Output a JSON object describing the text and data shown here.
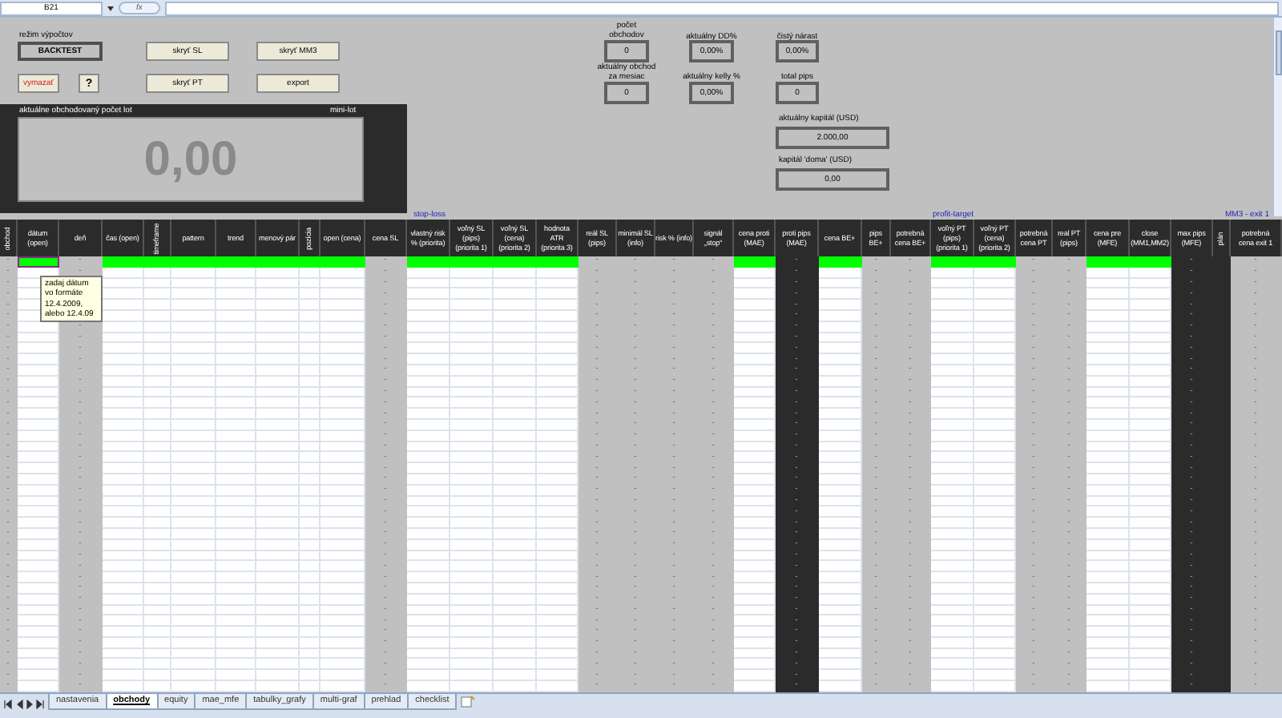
{
  "formula_bar": {
    "name_box": "B21",
    "function_label": "fx"
  },
  "mode": {
    "label": "režim výpočtov"
  },
  "buttons": [
    {
      "label": "BACKTEST",
      "kind": "mode"
    },
    {
      "label": "skryť SL",
      "kind": "action"
    },
    {
      "label": "skryť MM3",
      "kind": "action"
    },
    {
      "label": "vymazať",
      "kind": "danger"
    },
    {
      "label": "?",
      "kind": "action"
    },
    {
      "label": "skryť PT",
      "kind": "action"
    },
    {
      "label": "export",
      "kind": "action"
    }
  ],
  "lot_panel": {
    "title": "aktuálne obchodovaný počet lot",
    "unit": "mini-lot",
    "value": "0,00"
  },
  "stats": [
    {
      "label": "počet\nobchodov",
      "value": "0"
    },
    {
      "label": "aktuálny DD%",
      "value": "0,00%"
    },
    {
      "label": "čistý nárast",
      "value": "0,00%"
    },
    {
      "label": "aktuálny obchod\nza mesiac",
      "value": "0"
    },
    {
      "label": "aktuálny kelly %",
      "value": "0,00%"
    },
    {
      "label": "total pips",
      "value": "0"
    },
    {
      "label": "aktuálny kapitál (USD)",
      "value": "2.000,00"
    },
    {
      "label": "kapitál 'doma' (USD)",
      "value": "0,00"
    }
  ],
  "section_labels": [
    "stop-loss",
    "profit-target",
    "MM3 - exit 1"
  ],
  "columns": [
    {
      "header": "obchod",
      "kind": "gray",
      "rotated": true,
      "input_row": false,
      "active": false,
      "cells": [
        "-",
        "-",
        "-",
        "-",
        "-",
        "-",
        "-",
        "-",
        "-",
        "-",
        "-",
        "-",
        "-",
        "-",
        "-",
        "-",
        "-",
        "-",
        "-",
        "-",
        "-",
        "-",
        "-",
        "-",
        "-",
        "-",
        "-",
        "-",
        "-",
        "-",
        "-",
        "-",
        "-",
        "-",
        "-",
        "-",
        "-",
        "-",
        "-",
        "-"
      ]
    },
    {
      "header": "dátum\n(open)",
      "kind": "white",
      "rotated": false,
      "input_row": true,
      "active": true
    },
    {
      "header": "deň",
      "kind": "gray",
      "rotated": false,
      "input_row": false,
      "active": false,
      "cells": [
        "-",
        "-",
        null,
        null,
        null,
        null,
        "-",
        "-",
        "-",
        "-",
        "-",
        "-",
        "-",
        "-",
        "-",
        "-",
        "-",
        "-",
        "-",
        "-",
        "-",
        "-",
        "-",
        "-",
        "-",
        "-",
        "-",
        "-",
        "-",
        "-",
        "-",
        "-",
        "-",
        "-",
        "-",
        "-",
        "-",
        "-",
        "-",
        "-"
      ]
    },
    {
      "header": "čas (open)",
      "kind": "white",
      "rotated": false,
      "input_row": true,
      "active": false
    },
    {
      "header": "timeframe",
      "kind": "white",
      "rotated": true,
      "input_row": true,
      "active": false
    },
    {
      "header": "pattern",
      "kind": "white",
      "rotated": false,
      "input_row": true,
      "active": false
    },
    {
      "header": "trend",
      "kind": "white",
      "rotated": false,
      "input_row": true,
      "active": false
    },
    {
      "header": "menový pár",
      "kind": "white",
      "rotated": false,
      "input_row": true,
      "active": false
    },
    {
      "header": "pozícia",
      "kind": "white",
      "rotated": true,
      "input_row": true,
      "active": false
    },
    {
      "header": "open (cena)",
      "kind": "white",
      "rotated": false,
      "input_row": true,
      "active": false
    },
    {
      "header": "cena SL",
      "kind": "gray",
      "rotated": false,
      "input_row": false,
      "active": false,
      "cells": [
        "-",
        "-",
        "-",
        "-",
        "-",
        "-",
        "-",
        "-",
        "-",
        "-",
        "-",
        "-",
        "-",
        "-",
        "-",
        "-",
        "-",
        "-",
        "-",
        "-",
        "-",
        "-",
        "-",
        "-",
        "-",
        "-",
        "-",
        "-",
        "-",
        "-",
        "-",
        "-",
        "-",
        "-",
        "-",
        "-",
        "-",
        "-",
        "-",
        "-"
      ]
    },
    {
      "header": "vlastný risk\n% (priorita)",
      "kind": "white",
      "rotated": false,
      "input_row": true,
      "active": false
    },
    {
      "header": "voľný SL\n(pips)\n(priorita 1)",
      "kind": "white",
      "rotated": false,
      "input_row": true,
      "active": false
    },
    {
      "header": "voľný SL\n(cena)\n(priorita 2)",
      "kind": "white",
      "rotated": false,
      "input_row": true,
      "active": false
    },
    {
      "header": "hodnota\nATR\n(priorita 3)",
      "kind": "white",
      "rotated": false,
      "input_row": true,
      "active": false
    },
    {
      "header": "reál SL\n(pips)",
      "kind": "gray",
      "rotated": false,
      "input_row": false,
      "active": false,
      "cells": [
        "-",
        "-",
        "-",
        "-",
        "-",
        "-",
        "-",
        "-",
        "-",
        "-",
        "-",
        "-",
        "-",
        "-",
        "-",
        "-",
        "-",
        "-",
        "-",
        "-",
        "-",
        "-",
        "-",
        "-",
        "-",
        "-",
        "-",
        "-",
        "-",
        "-",
        "-",
        "-",
        "-",
        "-",
        "-",
        "-",
        "-",
        "-",
        "-",
        "-"
      ]
    },
    {
      "header": "minimál SL\n(info)",
      "kind": "gray",
      "rotated": false,
      "input_row": false,
      "active": false,
      "cells": [
        "-",
        "-",
        "-",
        "-",
        "-",
        "-",
        "-",
        "-",
        "-",
        "-",
        "-",
        "-",
        "-",
        "-",
        "-",
        "-",
        "-",
        "-",
        "-",
        "-",
        "-",
        "-",
        "-",
        "-",
        "-",
        "-",
        "-",
        "-",
        "-",
        "-",
        "-",
        "-",
        "-",
        "-",
        "-",
        "-",
        "-",
        "-",
        "-",
        "-"
      ]
    },
    {
      "header": "risk % (info)",
      "kind": "gray",
      "rotated": false,
      "input_row": false,
      "active": false,
      "cells": [
        "-",
        "-",
        "-",
        "-",
        "-",
        "-",
        "-",
        "-",
        "-",
        "-",
        "-",
        "-",
        "-",
        "-",
        "-",
        "-",
        "-",
        "-",
        "-",
        "-",
        "-",
        "-",
        "-",
        "-",
        "-",
        "-",
        "-",
        "-",
        "-",
        "-",
        "-",
        "-",
        "-",
        "-",
        "-",
        "-",
        "-",
        "-",
        "-",
        "-"
      ]
    },
    {
      "header": "signál\n„stop“",
      "kind": "gray",
      "rotated": false,
      "input_row": false,
      "active": false,
      "cells": [
        "-",
        "-",
        "-",
        "-",
        "-",
        "-",
        "-",
        "-",
        "-",
        "-",
        "-",
        "-",
        "-",
        "-",
        "-",
        "-",
        "-",
        "-",
        "-",
        "-",
        "-",
        "-",
        "-",
        "-",
        "-",
        "-",
        "-",
        "-",
        "-",
        "-",
        "-",
        "-",
        "-",
        "-",
        "-",
        "-",
        "-",
        "-",
        "-",
        "-"
      ]
    },
    {
      "header": "cena proti\n(MAE)",
      "kind": "white",
      "rotated": false,
      "input_row": true,
      "active": false
    },
    {
      "header": "proti pips\n(MAE)",
      "kind": "dark",
      "rotated": false,
      "input_row": false,
      "active": false,
      "cells": [
        "-",
        "-",
        "-",
        "-",
        "-",
        "-",
        "-",
        "-",
        "-",
        "-",
        "-",
        "-",
        "-",
        "-",
        "-",
        "-",
        "-",
        "-",
        "-",
        "-",
        "-",
        "-",
        "-",
        "-",
        "-",
        "-",
        "-",
        "-",
        "-",
        "-",
        "-",
        "-",
        "-",
        "-",
        "-",
        "-",
        "-",
        "-",
        "-",
        "-"
      ]
    },
    {
      "header": "cena BE+",
      "kind": "white",
      "rotated": false,
      "input_row": true,
      "active": false
    },
    {
      "header": "pips\nBE+",
      "kind": "gray",
      "rotated": false,
      "input_row": false,
      "active": false,
      "cells": [
        "-",
        "-",
        "-",
        "-",
        "-",
        "-",
        "-",
        "-",
        "-",
        "-",
        "-",
        "-",
        "-",
        "-",
        "-",
        "-",
        "-",
        "-",
        "-",
        "-",
        "-",
        "-",
        "-",
        "-",
        "-",
        "-",
        "-",
        "-",
        "-",
        "-",
        "-",
        "-",
        "-",
        "-",
        "-",
        "-",
        "-",
        "-",
        "-",
        "-"
      ]
    },
    {
      "header": "potrebná\ncena BE+",
      "kind": "gray",
      "rotated": false,
      "input_row": false,
      "active": false,
      "cells": [
        "-",
        "-",
        "-",
        "-",
        "-",
        "-",
        "-",
        "-",
        "-",
        "-",
        "-",
        "-",
        "-",
        "-",
        "-",
        "-",
        "-",
        "-",
        "-",
        "-",
        "-",
        "-",
        "-",
        "-",
        "-",
        "-",
        "-",
        "-",
        "-",
        "-",
        "-",
        "-",
        "-",
        "-",
        "-",
        "-",
        "-",
        "-",
        "-",
        "-"
      ]
    },
    {
      "header": "voľný PT\n(pips)\n(priorita 1)",
      "kind": "white",
      "rotated": false,
      "input_row": true,
      "active": false
    },
    {
      "header": "voľný PT\n(cena)\n(priorita 2)",
      "kind": "white",
      "rotated": false,
      "input_row": true,
      "active": false
    },
    {
      "header": "potrebná\ncena PT",
      "kind": "gray",
      "rotated": false,
      "input_row": false,
      "active": false,
      "cells": [
        "-",
        "-",
        "-",
        "-",
        "-",
        "-",
        "-",
        "-",
        "-",
        "-",
        "-",
        "-",
        "-",
        "-",
        "-",
        "-",
        "-",
        "-",
        "-",
        "-",
        "-",
        "-",
        "-",
        "-",
        "-",
        "-",
        "-",
        "-",
        "-",
        "-",
        "-",
        "-",
        "-",
        "-",
        "-",
        "-",
        "-",
        "-",
        "-",
        "-"
      ]
    },
    {
      "header": "real PT\n(pips)",
      "kind": "gray",
      "rotated": false,
      "input_row": false,
      "active": false,
      "cells": [
        "-",
        "-",
        "-",
        "-",
        "-",
        "-",
        "-",
        "-",
        "-",
        "-",
        "-",
        "-",
        "-",
        "-",
        "-",
        "-",
        "-",
        "-",
        "-",
        "-",
        "-",
        "-",
        "-",
        "-",
        "-",
        "-",
        "-",
        "-",
        "-",
        "-",
        "-",
        "-",
        "-",
        "-",
        "-",
        "-",
        "-",
        "-",
        "-",
        "-"
      ]
    },
    {
      "header": "cena pre\n(MFE)",
      "kind": "white",
      "rotated": false,
      "input_row": true,
      "active": false
    },
    {
      "header": "close\n(MM1,MM2)",
      "kind": "white",
      "rotated": false,
      "input_row": true,
      "active": false
    },
    {
      "header": "max pips\n(MFE)",
      "kind": "dark",
      "rotated": false,
      "input_row": false,
      "active": false,
      "cells": [
        "-",
        "-",
        "-",
        "-",
        "-",
        "-",
        "-",
        "-",
        "-",
        "-",
        "-",
        "-",
        "-",
        "-",
        "-",
        "-",
        "-",
        "-",
        "-",
        "-",
        "-",
        "-",
        "-",
        "-",
        "-",
        "-",
        "-",
        "-",
        "-",
        "-",
        "-",
        "-",
        "-",
        "-",
        "-",
        "-",
        "-",
        "-",
        "-",
        "-"
      ]
    },
    {
      "header": "plán",
      "kind": "dark",
      "rotated": true,
      "input_row": false,
      "active": false
    },
    {
      "header": "potrebná\ncena exit 1",
      "kind": "gray",
      "rotated": false,
      "input_row": false,
      "active": false,
      "cells": [
        "-",
        "-",
        "-",
        "-",
        "-",
        "-",
        "-",
        "-",
        "-",
        "-",
        "-",
        "-",
        "-",
        "-",
        "-",
        "-",
        "-",
        "-",
        "-",
        "-",
        "-",
        "-",
        "-",
        "-",
        "-",
        "-",
        "-",
        "-",
        "-",
        "-",
        "-",
        "-",
        "-",
        "-",
        "-",
        "-",
        "-",
        "-",
        "-",
        "-"
      ]
    }
  ],
  "tooltip": "zadaj dátum\nvo formáte\n12.4.2009,\nalebo 12.4.09",
  "sheet_tabs": [
    {
      "label": "nastavenia",
      "selected": false
    },
    {
      "label": "obchody",
      "selected": true
    },
    {
      "label": "equity",
      "selected": false
    },
    {
      "label": "mae_mfe",
      "selected": false
    },
    {
      "label": "tabulky_grafy",
      "selected": false
    },
    {
      "label": "multi-graf",
      "selected": false
    },
    {
      "label": "prehlad",
      "selected": false
    },
    {
      "label": "checklist",
      "selected": false
    }
  ]
}
